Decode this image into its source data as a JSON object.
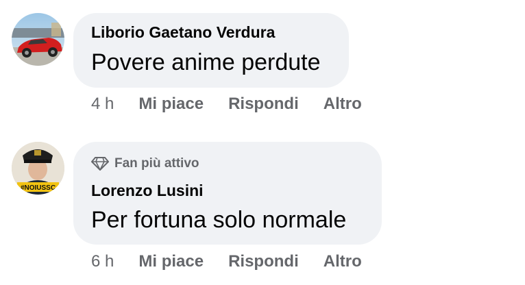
{
  "comments": [
    {
      "author": "Liborio Gaetano Verdura",
      "text": "Povere anime perdute",
      "badge": null,
      "time": "4 h",
      "actions": {
        "like": "Mi piace",
        "reply": "Rispondi",
        "more": "Altro"
      }
    },
    {
      "author": "Lorenzo Lusini",
      "text": "Per fortuna solo normale",
      "badge": "Fan più attivo",
      "time": "6 h",
      "actions": {
        "like": "Mi piace",
        "reply": "Rispondi",
        "more": "Altro"
      },
      "avatar_banner": "#NOIUSSC"
    }
  ],
  "colors": {
    "bubble": "#f0f2f5",
    "text": "#050505",
    "secondary": "#65676b"
  },
  "icons": {
    "badge": "diamond-icon"
  }
}
